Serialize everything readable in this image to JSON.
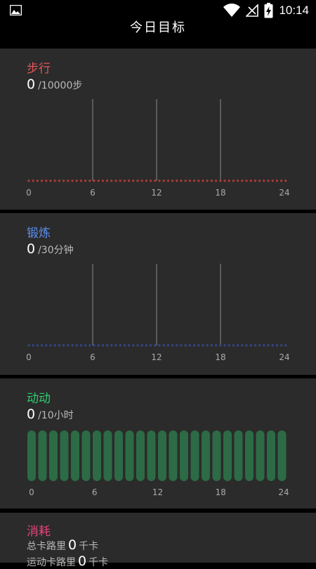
{
  "status_bar": {
    "time": "10:14"
  },
  "header": {
    "title": "今日目标"
  },
  "steps": {
    "title": "步行",
    "value": "0",
    "target": "/10000步",
    "color": "#e65454",
    "dot_color": "#b23b3b",
    "axis_labels": [
      "0",
      "6",
      "12",
      "18",
      "24"
    ]
  },
  "exercise": {
    "title": "锻炼",
    "value": "0",
    "target": "/30分钟",
    "color": "#5b8ef0",
    "dot_color": "#34498a",
    "axis_labels": [
      "0",
      "6",
      "12",
      "18",
      "24"
    ]
  },
  "active": {
    "title": "动动",
    "value": "0",
    "target": "/10小时",
    "color": "#2ecc71",
    "bar_color": "#2c6b45",
    "bar_count": 24,
    "axis_labels": [
      "0",
      "6",
      "12",
      "18",
      "24"
    ]
  },
  "consume": {
    "title": "消耗",
    "color": "#e8437a",
    "total_label": "总卡路里",
    "total_value": "0",
    "total_unit": "千卡",
    "sport_label": "运动卡路里",
    "sport_value": "0",
    "sport_unit": "千卡"
  }
}
